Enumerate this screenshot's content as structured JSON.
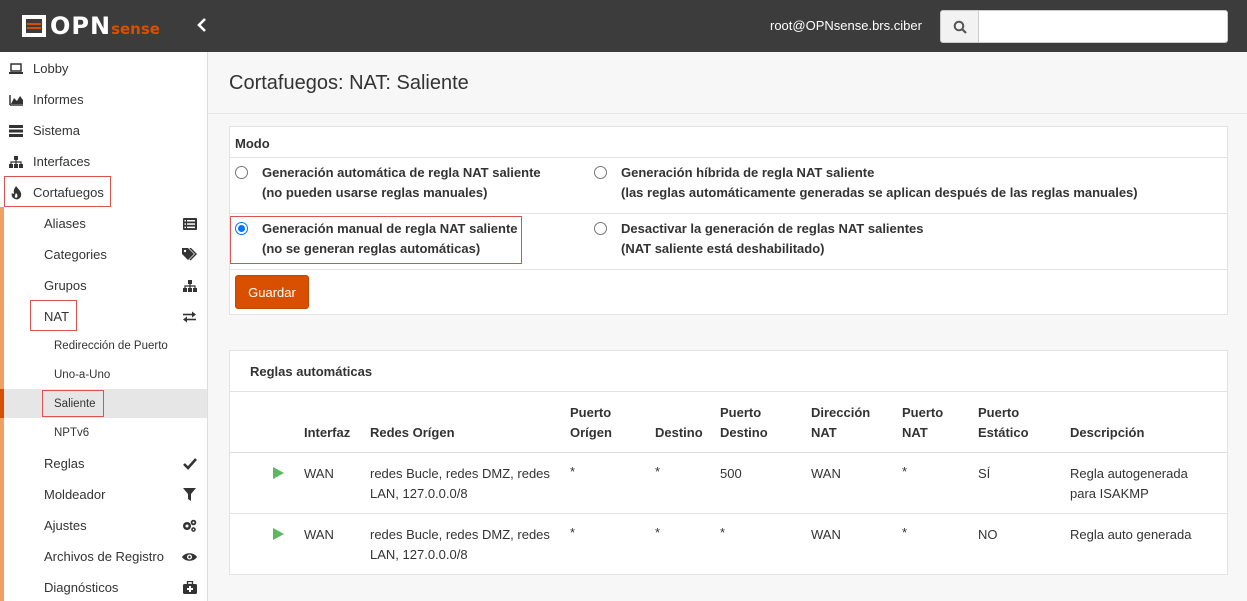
{
  "header": {
    "logo_text": "OPN",
    "logo_sense": "sense",
    "collapse_icon": "chevron-left-icon",
    "user": "root@OPNsense.brs.ciber",
    "search_placeholder": ""
  },
  "sidebar": {
    "items": [
      {
        "label": "Lobby",
        "icon": "laptop-icon"
      },
      {
        "label": "Informes",
        "icon": "area-chart-icon"
      },
      {
        "label": "Sistema",
        "icon": "server-icon"
      },
      {
        "label": "Interfaces",
        "icon": "sitemap-icon"
      },
      {
        "label": "Cortafuegos",
        "icon": "fire-icon"
      }
    ],
    "firewall_sub": [
      {
        "label": "Aliases",
        "icon": "list-icon"
      },
      {
        "label": "Categories",
        "icon": "tags-icon"
      },
      {
        "label": "Grupos",
        "icon": "sitemap-icon"
      },
      {
        "label": "NAT",
        "icon": "exchange-icon"
      },
      {
        "label": "Reglas",
        "icon": "check-icon"
      },
      {
        "label": "Moldeador",
        "icon": "filter-icon"
      },
      {
        "label": "Ajustes",
        "icon": "cogs-icon"
      },
      {
        "label": "Archivos de Registro",
        "icon": "eye-icon"
      },
      {
        "label": "Diagnósticos",
        "icon": "medkit-icon"
      }
    ],
    "nat_sub": [
      {
        "label": "Redirección de Puerto"
      },
      {
        "label": "Uno-a-Uno"
      },
      {
        "label": "Saliente"
      },
      {
        "label": "NPTv6"
      }
    ]
  },
  "page": {
    "title": "Cortafuegos: NAT: Saliente"
  },
  "modo": {
    "heading": "Modo",
    "options": [
      {
        "line1": "Generación automática de regla NAT saliente",
        "line2": "(no pueden usarse reglas manuales)",
        "checked": false
      },
      {
        "line1": "Generación híbrida de regla NAT saliente",
        "line2": "(las reglas automáticamente generadas se aplican después de las reglas manuales)",
        "checked": false
      },
      {
        "line1": "Generación manual de regla NAT saliente",
        "line2": "(no se generan reglas automáticas)",
        "checked": true
      },
      {
        "line1": "Desactivar la generación de reglas NAT salientes",
        "line2": "(NAT saliente está deshabilitado)",
        "checked": false
      }
    ],
    "save_label": "Guardar",
    "accent_color": "#d94f00"
  },
  "rules": {
    "title": "Reglas automáticas",
    "columns": {
      "interfaz": "Interfaz",
      "redes_origen": "Redes Orígen",
      "puerto_origen_1": "Puerto",
      "puerto_origen_2": "Orígen",
      "destino": "Destino",
      "puerto_destino_1": "Puerto",
      "puerto_destino_2": "Destino",
      "direccion_nat_1": "Dirección",
      "direccion_nat_2": "NAT",
      "puerto_nat_1": "Puerto",
      "puerto_nat_2": "NAT",
      "puerto_estatico_1": "Puerto",
      "puerto_estatico_2": "Estático",
      "descripcion": "Descripción"
    },
    "rows": [
      {
        "interfaz": "WAN",
        "redes_1": "redes Bucle, redes DMZ, redes",
        "redes_2": "LAN, 127.0.0.0/8",
        "puerto_origen": "*",
        "destino": "*",
        "puerto_destino": "500",
        "direccion_nat": "WAN",
        "puerto_nat": "*",
        "puerto_estatico": "SÍ",
        "descripcion_1": "Regla autogenerada",
        "descripcion_2": "para ISAKMP"
      },
      {
        "interfaz": "WAN",
        "redes_1": "redes Bucle, redes DMZ, redes",
        "redes_2": "LAN, 127.0.0.0/8",
        "puerto_origen": "*",
        "destino": "*",
        "puerto_destino": "*",
        "direccion_nat": "WAN",
        "puerto_nat": "*",
        "puerto_estatico": "NO",
        "descripcion_1": "Regla auto generada",
        "descripcion_2": ""
      }
    ]
  }
}
